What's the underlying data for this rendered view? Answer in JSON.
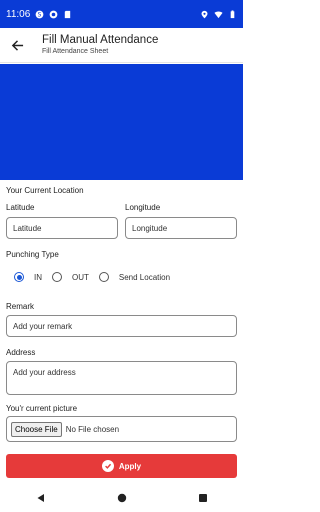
{
  "status_bar": {
    "time": "11:06"
  },
  "app_bar": {
    "title": "Fill Manual Attendance",
    "subtitle": "Fill Attendance Sheet"
  },
  "form": {
    "location_heading": "Your Current Location",
    "latitude_label": "Latitude",
    "latitude_placeholder": "Latitude",
    "longitude_label": "Longitude",
    "longitude_placeholder": "Longitude",
    "punching_heading": "Punching Type",
    "punching_options": [
      "IN",
      "OUT",
      "Send Location"
    ],
    "punching_selected": "IN",
    "remark_label": "Remark",
    "remark_placeholder": "Add your remark",
    "address_label": "Address",
    "address_placeholder": "Add your address",
    "picture_label": "You'r current picture",
    "choose_file_label": "Choose File",
    "no_file_text": "No File chosen",
    "apply_label": "Apply"
  },
  "colors": {
    "primary": "#0a3bd6",
    "apply": "#e63a3a",
    "radio": "#1a57d6"
  },
  "icons": {
    "back": "arrow-left-icon",
    "apply": "check-circle-icon"
  }
}
